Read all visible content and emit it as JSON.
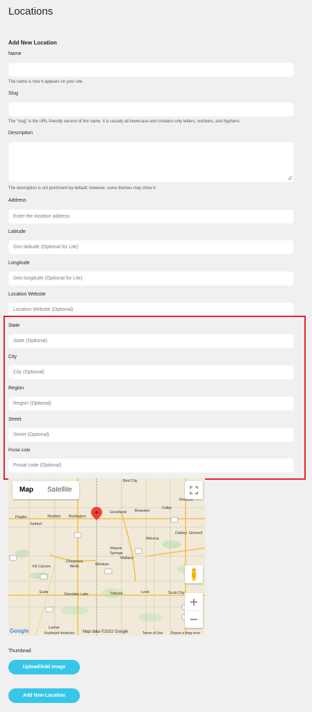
{
  "page": {
    "title": "Locations"
  },
  "form": {
    "section_title": "Add New Location",
    "name": {
      "label": "Name",
      "value": "",
      "help": "The name is how it appears on your site."
    },
    "slug": {
      "label": "Slug",
      "value": "",
      "help": "The “slug” is the URL-friendly version of the name. It is usually all lowercase and contains only letters, numbers, and hyphens."
    },
    "description": {
      "label": "Description",
      "value": "",
      "help": "The description is not prominent by default; however, some themes may show it."
    },
    "address": {
      "label": "Address",
      "placeholder": "Enter the location address"
    },
    "latitude": {
      "label": "Latitude",
      "placeholder": "Geo latitude (Optional for Lite)"
    },
    "longitude": {
      "label": "Longitude",
      "placeholder": "Geo longitude (Optional for Lite)"
    },
    "website": {
      "label": "Location Website",
      "placeholder": "Location Website (Optional)"
    },
    "state": {
      "label": "State",
      "placeholder": "State (Optional)"
    },
    "city": {
      "label": "City",
      "placeholder": "City (Optional)"
    },
    "region": {
      "label": "Region",
      "placeholder": "Region (Optional)"
    },
    "street": {
      "label": "Street",
      "placeholder": "Street (Optional)"
    },
    "postal": {
      "label": "Postal code",
      "placeholder": "Postal code (Optional)"
    }
  },
  "map": {
    "type_map": "Map",
    "type_satellite": "Satellite",
    "zoom_in": "+",
    "zoom_out": "−",
    "footer": {
      "logo": "Google",
      "shortcuts": "Keyboard shortcuts",
      "data": "Map data ©2022 Google",
      "terms": "Terms of Use",
      "report": "Report a map error"
    },
    "places": {
      "bird_city": "Bird City",
      "rexford": "Rexford",
      "flagler": "Flagler",
      "stratton": "Stratton",
      "burlington": "Burlington",
      "goodland": "Goodland",
      "brewster": "Brewster",
      "colby": "Colby",
      "seibert": "Seibert",
      "oakley": "Oakley",
      "grinnell": "Grinnell",
      "winona": "Winona",
      "sharon_springs": "Sharon Springs",
      "wallace": "Wallace",
      "cheyenne_wells": "Cheyenne Wells",
      "weskan": "Weskan",
      "kit_carson": "Kit Carson",
      "eads": "Eads",
      "sheridan_lake": "Sheridan Lake",
      "tribune": "Tribune",
      "leoti": "Leoti",
      "scott_city": "Scott City",
      "lamar": "Lamar"
    },
    "routes": [
      "385",
      "24",
      "40",
      "27",
      "287",
      "25",
      "96",
      "83",
      "59",
      "24"
    ]
  },
  "thumbnail": {
    "label": "Thumbnail",
    "upload_button": "Upload/Add image"
  },
  "submit_button": "Add New Location",
  "colors": {
    "accent": "#37c6e8",
    "highlight": "#e0242a",
    "map_bg": "#f2ead8"
  }
}
